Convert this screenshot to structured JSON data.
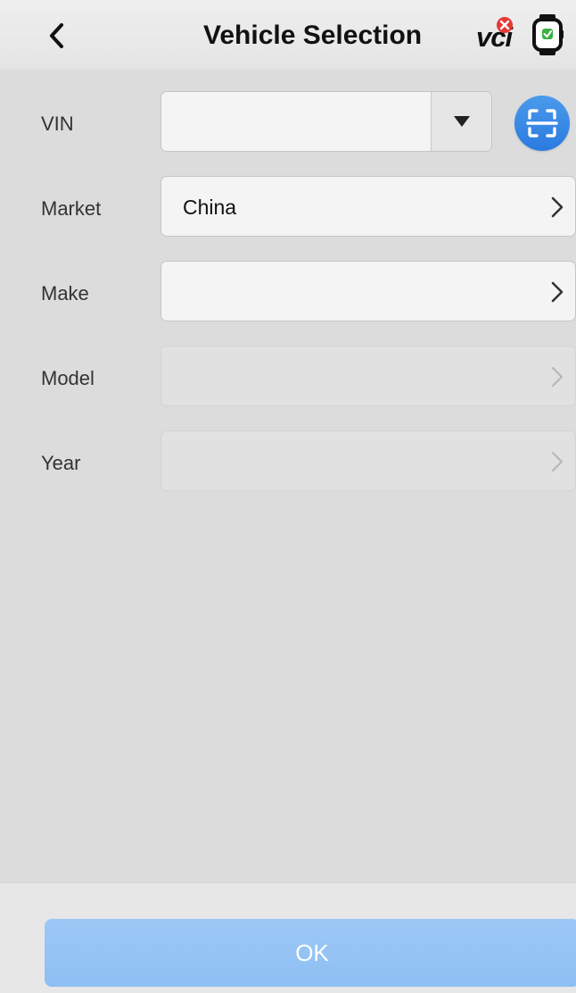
{
  "header": {
    "back_icon": "chevron-left-icon",
    "title": "Vehicle Selection",
    "vci_label": "vci",
    "vci_status_icon": "error-x-icon",
    "device_icon": "smartwatch-icon"
  },
  "form": {
    "vin": {
      "label": "VIN",
      "value": "",
      "dropdown_icon": "triangle-down-icon",
      "scan_icon": "scan-frame-icon"
    },
    "market": {
      "label": "Market",
      "value": "China"
    },
    "make": {
      "label": "Make",
      "value": ""
    },
    "model": {
      "label": "Model",
      "value": ""
    },
    "year": {
      "label": "Year",
      "value": ""
    }
  },
  "footer": {
    "ok_label": "OK"
  },
  "colors": {
    "accent": "#2a7be0",
    "ok_button": "#94c3f5",
    "error_badge": "#e53935",
    "watch_check": "#3cb043"
  }
}
